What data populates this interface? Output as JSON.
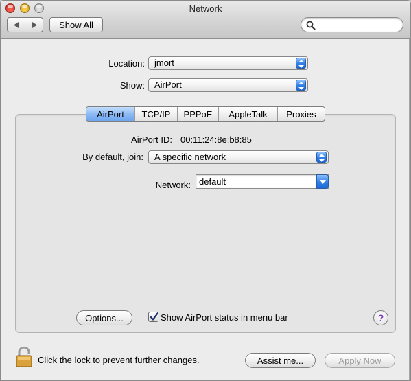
{
  "window": {
    "title": "Network"
  },
  "toolbar": {
    "back_icon": "triangle-left-icon",
    "forward_icon": "triangle-right-icon",
    "show_all_label": "Show All",
    "search_placeholder": "",
    "search_value": ""
  },
  "location": {
    "label": "Location:",
    "value": "jmort"
  },
  "show": {
    "label": "Show:",
    "value": "AirPort"
  },
  "tabs": [
    {
      "label": "AirPort",
      "active": true
    },
    {
      "label": "TCP/IP",
      "active": false
    },
    {
      "label": "PPPoE",
      "active": false
    },
    {
      "label": "AppleTalk",
      "active": false
    },
    {
      "label": "Proxies",
      "active": false
    }
  ],
  "airport": {
    "id_label": "AirPort ID:",
    "id_value": "00:11:24:8e:b8:85",
    "join_label": "By default, join:",
    "join_value": "A specific network",
    "network_label": "Network:",
    "network_value": "default",
    "options_label": "Options...",
    "status_checkbox_label": "Show AirPort status in menu bar",
    "status_checkbox_checked": true,
    "help_label": "?"
  },
  "footer": {
    "lock_text": "Click the lock to prevent further changes.",
    "assist_label": "Assist me...",
    "apply_label": "Apply Now"
  },
  "colors": {
    "accent_blue": "#2f7fe6",
    "tab_active": "#8dbaf3",
    "window_bg": "#ececec",
    "help_purple": "#7a3bbd"
  }
}
